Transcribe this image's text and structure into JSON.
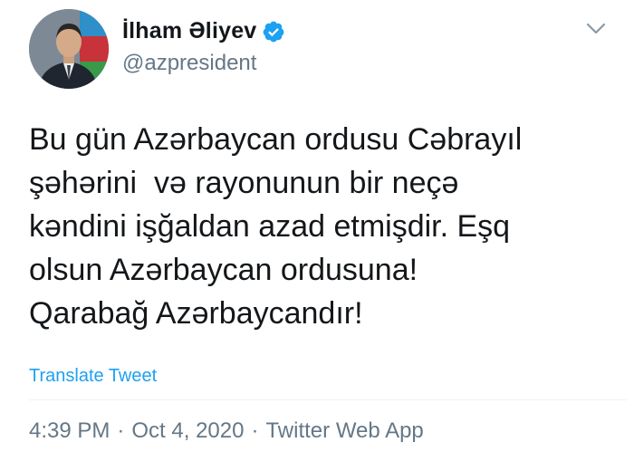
{
  "author": {
    "name": "İlham Əliyev",
    "handle": "@azpresident",
    "verified": true
  },
  "tweet": {
    "text": "Bu gün Azərbaycan ordusu Cəbrayıl\nşəhərini  və rayonunun bir neçə\nkəndini işğaldan azad etmişdir. Eşq\nolsun Azərbaycan ordusuna!\nQarabağ Azərbaycandır!",
    "translate_label": "Translate Tweet"
  },
  "meta": {
    "time": "4:39 PM",
    "separator": "·",
    "date": "Oct 4, 2020",
    "source": "Twitter Web App"
  },
  "icons": {
    "verified": "verified-badge-icon",
    "menu": "chevron-down-icon"
  },
  "colors": {
    "text": "#14171a",
    "secondary": "#657786",
    "link": "#1da1f2",
    "verified": "#1da1f2"
  }
}
